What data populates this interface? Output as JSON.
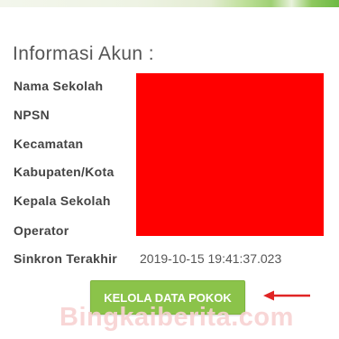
{
  "info": {
    "title": "Informasi Akun :",
    "fields": [
      {
        "label": "Nama Sekolah"
      },
      {
        "label": "NPSN"
      },
      {
        "label": "Kecamatan"
      },
      {
        "label": "Kabupaten/Kota"
      },
      {
        "label": "Kepala Sekolah"
      },
      {
        "label": "Operator"
      }
    ],
    "sync_label": "Sinkron Terakhir",
    "sync_value": "2019-10-15 19:41:37.023"
  },
  "actions": {
    "manage_label": "KELOLA DATA POKOK"
  },
  "annotation": {
    "arrow_color": "#e02424"
  },
  "watermark": {
    "text": "Bingkaiberita.com"
  },
  "colors": {
    "button": "#8bc34a",
    "redaction": "#ff0000"
  }
}
